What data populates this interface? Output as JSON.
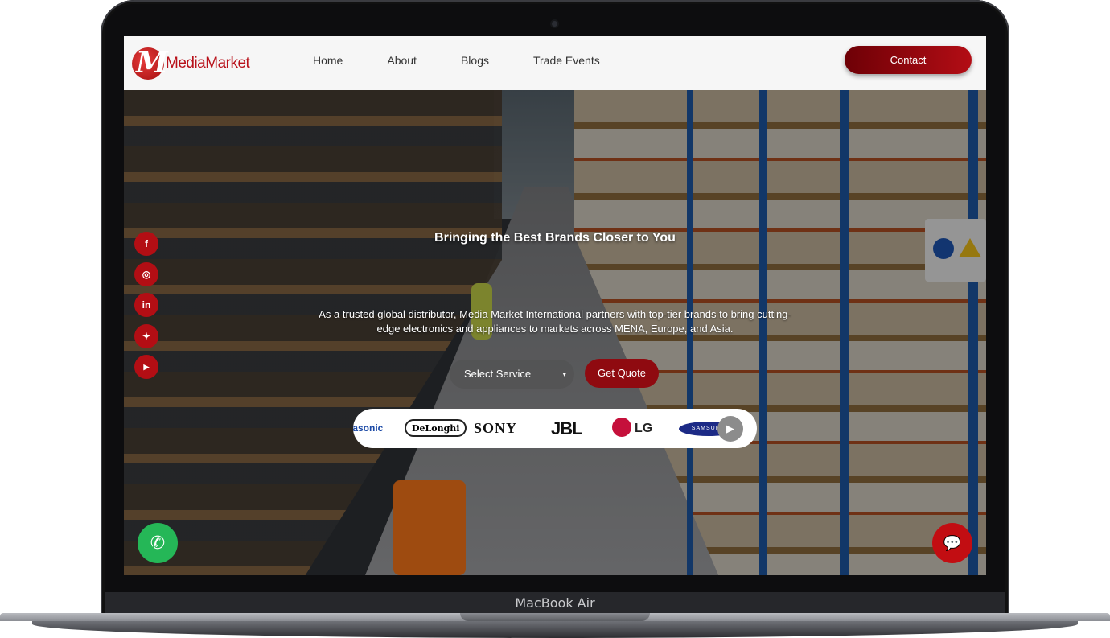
{
  "device": {
    "model_label": "MacBook Air"
  },
  "header": {
    "logo_text": "MediaMarket",
    "nav": [
      {
        "label": "Home"
      },
      {
        "label": "About"
      },
      {
        "label": "Blogs"
      },
      {
        "label": "Trade Events"
      }
    ],
    "contact_label": "Contact"
  },
  "hero": {
    "title": "Bringing the Best Brands Closer to You",
    "description": "As a trusted global distributor, Media Market International partners with top-tier brands to bring cutting-edge electronics and appliances to markets across MENA, Europe, and Asia.",
    "select_service": {
      "value": "Select Service",
      "caret": "▾"
    },
    "get_quote_label": "Get Quote"
  },
  "brands": {
    "items": [
      "nasonic",
      "DeLonghi",
      "SONY",
      "JBL",
      "LG",
      "SAMSUNG"
    ],
    "next_icon": "▶"
  },
  "social": [
    {
      "icon": "facebook-icon",
      "glyph": "f"
    },
    {
      "icon": "instagram-icon",
      "glyph": "◎"
    },
    {
      "icon": "linkedin-icon",
      "glyph": "in"
    },
    {
      "icon": "twitter-icon",
      "glyph": "✦"
    },
    {
      "icon": "youtube-icon",
      "glyph": "▶"
    }
  ],
  "floating": {
    "whatsapp_glyph": "✆",
    "chat_glyph": "💬"
  },
  "colors": {
    "brand_red": "#b30e14",
    "contact_gradient_start": "#6e0006",
    "whatsapp_green": "#25b757"
  }
}
